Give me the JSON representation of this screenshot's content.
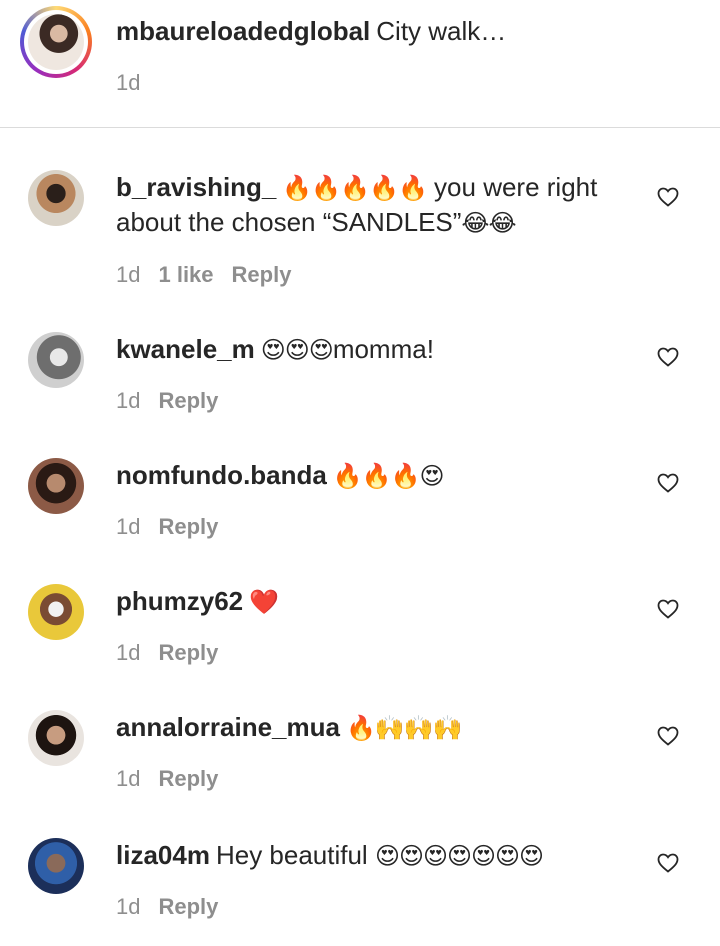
{
  "caption": {
    "username": "mbaureloadedglobal",
    "text": "City walk…",
    "time": "1d"
  },
  "comments": [
    {
      "username": "b_ravishing_",
      "emoji_before": "🔥🔥🔥🔥🔥",
      "text_line1": " you were right",
      "text_line2": "about the chosen “SANDLES”",
      "emoji_after": "😂😂",
      "time": "1d",
      "likes": "1 like",
      "reply_label": "Reply"
    },
    {
      "username": "kwanele_m",
      "emoji_before": "😍😍😍",
      "text": "momma!",
      "time": "1d",
      "reply_label": "Reply"
    },
    {
      "username": "nomfundo.banda",
      "emoji_before": "🔥🔥🔥😍",
      "time": "1d",
      "reply_label": "Reply"
    },
    {
      "username": "phumzy62",
      "emoji_before": "❤️",
      "time": "1d",
      "reply_label": "Reply"
    },
    {
      "username": "annalorraine_mua",
      "emoji_before": "🔥🙌🙌🙌",
      "time": "1d",
      "reply_label": "Reply"
    },
    {
      "username": "liza04m",
      "text": "Hey beautiful ",
      "emoji_after": "😍😍😍😍😍😍😍",
      "time": "1d",
      "reply_label": "Reply"
    }
  ],
  "colors": {
    "text": "#262626",
    "secondary": "#8e8e8e",
    "divider": "#dbdbdb"
  }
}
